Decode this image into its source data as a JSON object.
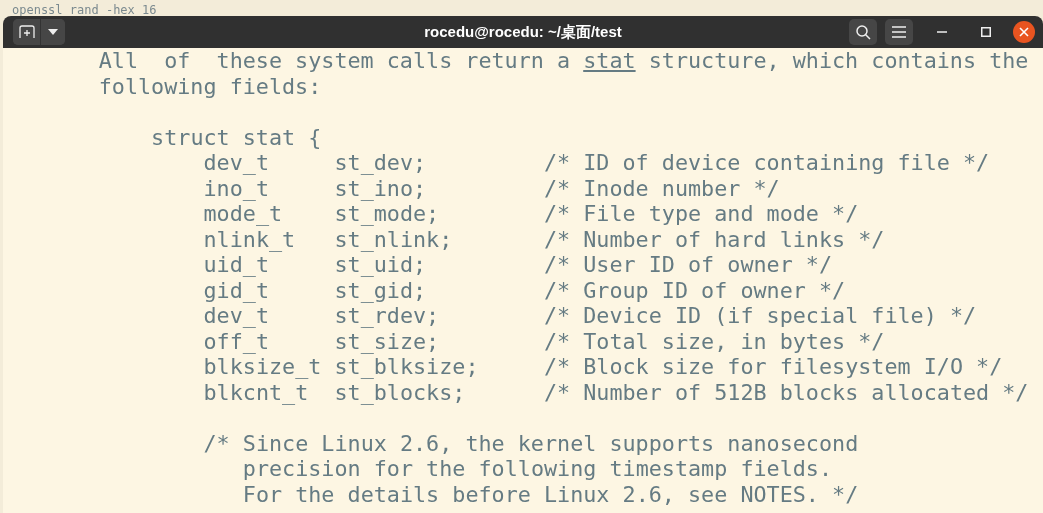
{
  "background_window": {
    "text": "openssl rand -hex 16"
  },
  "window": {
    "title": "rocedu@rocedu: ~/桌面/test"
  },
  "terminal": {
    "lines": [
      {
        "kind": "paragraph",
        "parts": [
          {
            "text": "All  of  these system calls return a ",
            "kind": "plain"
          },
          {
            "text": "stat",
            "kind": "reference"
          },
          {
            "text": " structure, which contains the",
            "kind": "plain"
          }
        ]
      },
      {
        "kind": "paragraph",
        "parts": [
          {
            "text": "following fields:",
            "kind": "plain"
          }
        ]
      },
      {
        "kind": "blank"
      },
      {
        "kind": "struct",
        "parts": [
          {
            "text": "struct stat {",
            "kind": "plain"
          }
        ]
      },
      {
        "kind": "member",
        "parts": [
          {
            "text": "dev_t     st_dev;         /* ID of device containing file */",
            "kind": "plain"
          }
        ]
      },
      {
        "kind": "member",
        "parts": [
          {
            "text": "ino_t     st_ino;         /* Inode number */",
            "kind": "plain"
          }
        ]
      },
      {
        "kind": "member",
        "parts": [
          {
            "text": "mode_t    st_mode;        /* File type and mode */",
            "kind": "plain"
          }
        ]
      },
      {
        "kind": "member",
        "parts": [
          {
            "text": "nlink_t   st_nlink;       /* Number of hard links */",
            "kind": "plain"
          }
        ]
      },
      {
        "kind": "member",
        "parts": [
          {
            "text": "uid_t     st_uid;         /* User ID of owner */",
            "kind": "plain"
          }
        ]
      },
      {
        "kind": "member",
        "parts": [
          {
            "text": "gid_t     st_gid;         /* Group ID of owner */",
            "kind": "plain"
          }
        ]
      },
      {
        "kind": "member",
        "parts": [
          {
            "text": "dev_t     st_rdev;        /* Device ID (if special file) */",
            "kind": "plain"
          }
        ]
      },
      {
        "kind": "member",
        "parts": [
          {
            "text": "off_t     st_size;        /* Total size, in bytes */",
            "kind": "plain"
          }
        ]
      },
      {
        "kind": "member",
        "parts": [
          {
            "text": "blksize_t st_blksize;     /* Block size for filesystem I/O */",
            "kind": "plain"
          }
        ]
      },
      {
        "kind": "member",
        "parts": [
          {
            "text": "blkcnt_t  st_blocks;      /* Number of 512B blocks allocated */",
            "kind": "plain"
          }
        ]
      },
      {
        "kind": "blank"
      },
      {
        "kind": "member",
        "parts": [
          {
            "text": "/* Since Linux 2.6, the kernel supports nanosecond",
            "kind": "plain"
          }
        ]
      },
      {
        "kind": "continuation",
        "parts": [
          {
            "text": "precision for the following timestamp fields.",
            "kind": "plain"
          }
        ]
      },
      {
        "kind": "continuation",
        "parts": [
          {
            "text": "For the details before Linux 2.6, see NOTES. */",
            "kind": "plain"
          }
        ]
      }
    ]
  }
}
